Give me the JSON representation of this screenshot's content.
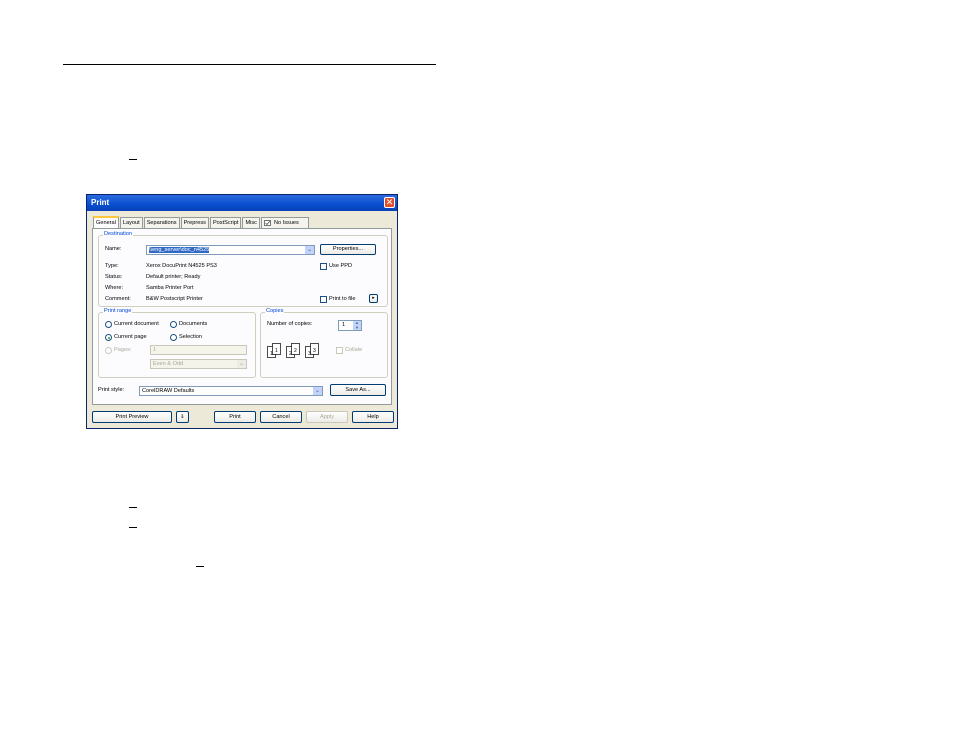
{
  "dialog": {
    "title": "Print",
    "close_glyph": "✕",
    "tabs": [
      "General",
      "Layout",
      "Separations",
      "Prepress",
      "PostScript",
      "Misc",
      "No Issues"
    ],
    "destination": {
      "legend": "Destination",
      "name_label": "Name:",
      "name_value": "\\\\eng_server\\doc_n4525",
      "properties_button": "Properties...",
      "type_label": "Type:",
      "type_value": "Xerox DocuPrint N4525 PS3",
      "status_label": "Status:",
      "status_value": "Default printer; Ready",
      "where_label": "Where:",
      "where_value": "Samba Printer Port",
      "comment_label": "Comment:",
      "comment_value": "B&W Postscript Printer",
      "use_ppd_label": "Use PPD",
      "print_to_file_label": "Print to file"
    },
    "print_range": {
      "legend": "Print range",
      "current_document": "Current document",
      "documents": "Documents",
      "current_page": "Current page",
      "selection": "Selection",
      "pages_label": "Pages:",
      "pages_value": "1",
      "pages_filter": "Even & Odd"
    },
    "copies": {
      "legend": "Copies",
      "number_label": "Number of copies:",
      "number_value": "1",
      "collate_label": "Collate",
      "page_icon_numbers": [
        "1",
        "1",
        "2",
        "2",
        "3",
        "3"
      ]
    },
    "print_style": {
      "label": "Print style:",
      "value": "CorelDRAW Defaults",
      "save_as_button": "Save As..."
    },
    "footer": {
      "print_preview": "Print Preview",
      "print": "Print",
      "cancel": "Cancel",
      "apply": "Apply",
      "help": "Help"
    }
  }
}
